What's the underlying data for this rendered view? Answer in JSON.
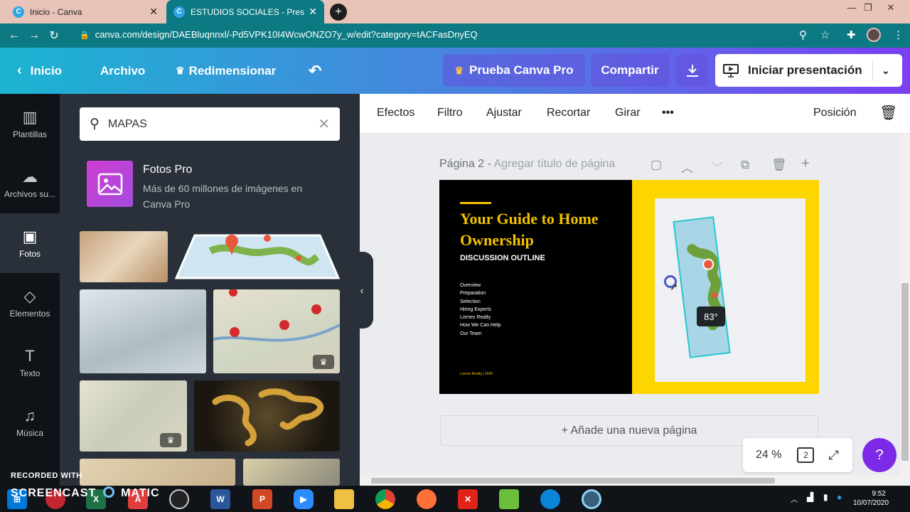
{
  "browser": {
    "tabs": [
      {
        "title": "Inicio - Canva",
        "favicon": "C"
      },
      {
        "title": "ESTUDIOS SOCIALES - Presentaci",
        "favicon": "C"
      }
    ],
    "url": "canva.com/design/DAEBluqnnxl/-Pd5VPK10I4WcwONZO7y_w/edit?category=tACFasDnyEQ"
  },
  "header": {
    "home": "Inicio",
    "file": "Archivo",
    "resize": "Redimensionar",
    "try_pro": "Prueba Canva Pro",
    "share": "Compartir",
    "present": "Iniciar presentación"
  },
  "rail": [
    {
      "label": "Plantillas",
      "icon": "templates-icon"
    },
    {
      "label": "Archivos su...",
      "icon": "upload-cloud-icon"
    },
    {
      "label": "Fotos",
      "icon": "photo-icon"
    },
    {
      "label": "Elementos",
      "icon": "elements-icon"
    },
    {
      "label": "Texto",
      "icon": "text-icon"
    },
    {
      "label": "Música",
      "icon": "music-icon"
    }
  ],
  "panel": {
    "search_value": "MAPAS",
    "fotos_pro_title": "Fotos Pro",
    "fotos_pro_desc": "Más de 60 millones de imágenes en Canva Pro"
  },
  "toolbar": {
    "effects": "Efectos",
    "filter": "Filtro",
    "adjust": "Ajustar",
    "crop": "Recortar",
    "rotate": "Girar",
    "position": "Posición"
  },
  "canvas": {
    "page_label": "Página 2 -",
    "page_title_placeholder": "Agregar título de página",
    "add_page": "+ Añade una nueva página",
    "zoom": "24 %",
    "page_count": "2",
    "rotation": "83°"
  },
  "slide": {
    "title": "Your Guide to Home Ownership",
    "subtitle": "DISCUSSION OUTLINE",
    "outline": [
      "Overview",
      "Preparation",
      "Selection",
      "Hiring Experts",
      "Lornes Realty",
      "How We Can Help",
      "Our Team"
    ],
    "footer": "Lornes Realty | 2020"
  },
  "taskbar": {
    "recorded_with": "RECORDED WITH",
    "brand": "SCREENCAST",
    "brand_suffix": "MATIC",
    "time": "9:52",
    "date": "10/07/2020"
  },
  "colors": {
    "header_start": "#1bb4d2",
    "header_end": "#7a3ff2",
    "slide_yellow": "#fdd600",
    "help_purple": "#7d2ae8"
  }
}
